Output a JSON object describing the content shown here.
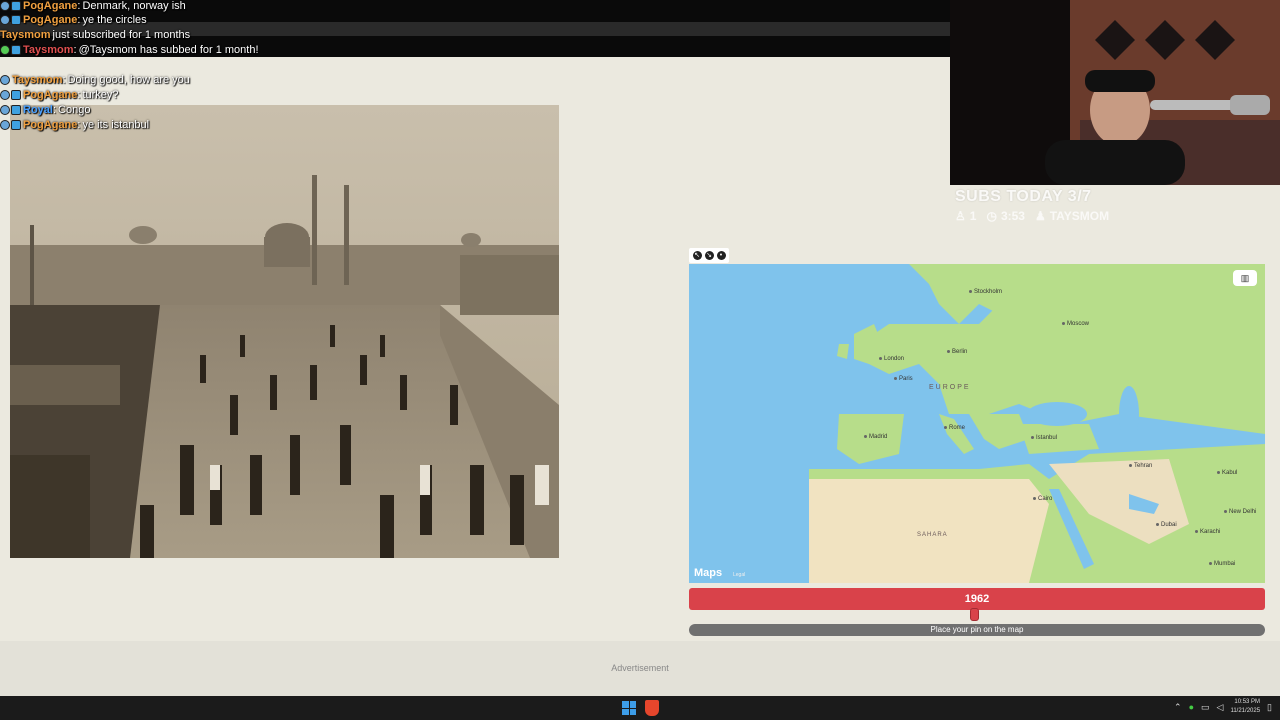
{
  "chat": [
    {
      "user": "PogAgane",
      "user_color": "#f0a040",
      "message": "Denmark, norway ish"
    },
    {
      "user": "PogAgane",
      "user_color": "#f0a040",
      "message": "ye the circles"
    },
    {
      "user": "Taysmom",
      "user_color": "#f0a040",
      "message": "just subscribed for 1 months"
    },
    {
      "user": "Taysmom",
      "user_color": "#e05050",
      "message": "@Taysmom has subbed for 1 month!"
    },
    {
      "user": "Taysmom",
      "user_color": "#f0a040",
      "message": "Doing good, how are you"
    },
    {
      "user": "PogAgane",
      "user_color": "#f0a040",
      "message": "turkey?"
    },
    {
      "user": "Royal",
      "user_color": "#4aa0ff",
      "message": "Congo"
    },
    {
      "user": "PogAgane",
      "user_color": "#f0a040",
      "message": "ye its istanbul"
    }
  ],
  "stream": {
    "subs_today": "SUBS TODAY 3/7",
    "stat_count": "1",
    "stat_time": "3:53",
    "stat_user": "TAYSMOM"
  },
  "map": {
    "region_label": "EUROPE",
    "sahara_label": "SAHARA",
    "cities": [
      "Stockholm",
      "Moscow",
      "London",
      "Berlin",
      "Paris",
      "Madrid",
      "Rome",
      "Istanbul",
      "Tehran",
      "Kabul",
      "Cairo",
      "Dubai",
      "Karachi",
      "New Delhi",
      "Mumbai"
    ],
    "logo": "Maps",
    "legal": "Legal"
  },
  "year": "1962",
  "place_pin": "Place your pin on the map",
  "advertisement": "Advertisement",
  "clock": {
    "time": "10:53 PM",
    "date": "11/21/2025"
  },
  "colors": {
    "accent": "#d9424a",
    "map_water": "#7fc3ec",
    "land": "#b7dd8a"
  }
}
